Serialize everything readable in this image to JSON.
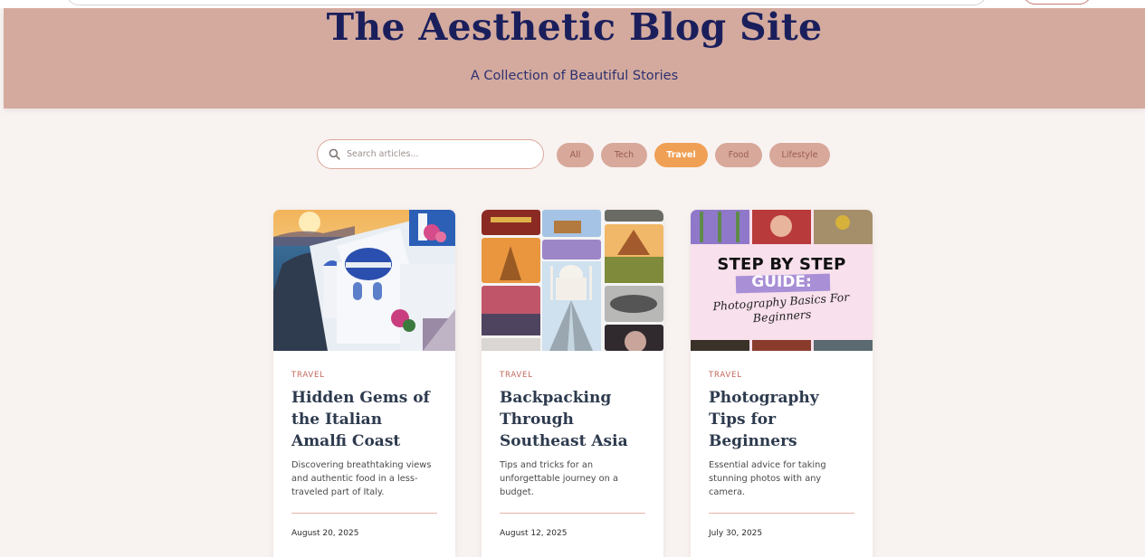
{
  "header": {
    "title": "The Aesthetic Blog Site",
    "subtitle": "A Collection of Beautiful Stories"
  },
  "search": {
    "placeholder": "Search articles..."
  },
  "filters": [
    {
      "label": "All",
      "active": false
    },
    {
      "label": "Tech",
      "active": false
    },
    {
      "label": "Travel",
      "active": true
    },
    {
      "label": "Food",
      "active": false
    },
    {
      "label": "Lifestyle",
      "active": false
    }
  ],
  "cards": [
    {
      "category": "TRAVEL",
      "title": "Hidden Gems of the Italian Amalfi Coast",
      "description": "Discovering breathtaking views and authentic food in a less-traveled part of Italy.",
      "date": "August 20, 2025"
    },
    {
      "category": "TRAVEL",
      "title": "Backpacking Through Southeast Asia",
      "description": "Tips and tricks for an unforgettable journey on a budget.",
      "date": "August 12, 2025"
    },
    {
      "category": "TRAVEL",
      "title": "Photography Tips for Beginners",
      "description": "Essential advice for taking stunning photos with any camera.",
      "date": "July 30, 2025",
      "image_text": {
        "line1": "STEP BY STEP",
        "line2": "GUIDE:",
        "line3": "Photography Basics For Beginners"
      }
    }
  ],
  "colors": {
    "header_bg": "#d4aa9e",
    "title": "#1a1f5c",
    "accent_active": "#f0a055",
    "chip": "#d8a89b",
    "page_bg": "#f8f3f1"
  }
}
